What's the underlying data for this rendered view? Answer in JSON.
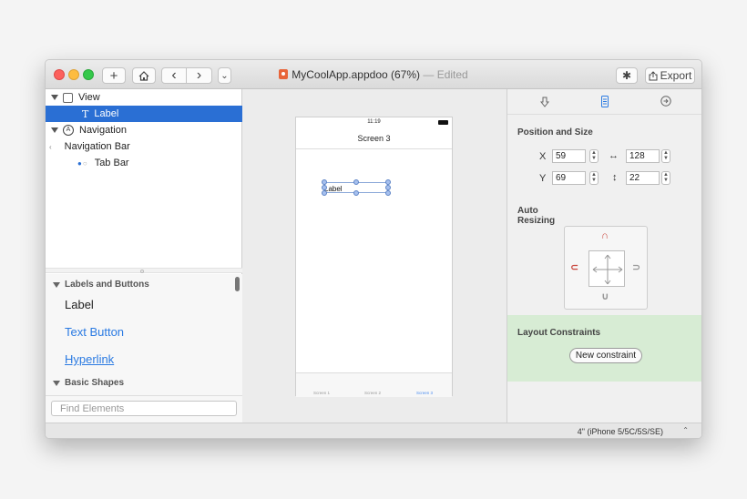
{
  "window": {
    "title_file": "MyCoolApp.appdoo (67%)",
    "title_status": "— Edited",
    "toolbar": {
      "add_icon": "+",
      "home_icon": "house-icon",
      "back_icon": "‹",
      "forward_icon": "›",
      "menu_icon": "⌄",
      "settings_icon": "✱",
      "export_label": "Export"
    }
  },
  "tree": {
    "items": [
      {
        "label": "View",
        "icon": "view-box-icon"
      },
      {
        "label": "Label",
        "icon": "T"
      },
      {
        "label": "Navigation",
        "icon": "navigation-icon"
      },
      {
        "label": "Navigation Bar",
        "icon": "‹"
      },
      {
        "label": "Tab Bar",
        "icon": "tab-dots-icon"
      }
    ]
  },
  "library": {
    "sections": [
      {
        "title": "Labels and Buttons",
        "items": [
          "Label",
          "Text Button",
          "Hyperlink"
        ]
      },
      {
        "title": "Basic Shapes",
        "items": []
      }
    ],
    "search_placeholder": "Find Elements"
  },
  "canvas": {
    "status_time": "11:19",
    "screen_title": "Screen 3",
    "label_text": "Label",
    "tabs": [
      "Screen 1",
      "Screen 2",
      "Screen 3"
    ]
  },
  "inspector": {
    "position_title": "Position and Size",
    "x_label": "X",
    "x_value": "59",
    "y_label": "Y",
    "y_value": "69",
    "width_icon": "↔",
    "width_value": "128",
    "height_icon": "↕",
    "height_value": "22",
    "auto_resizing_line1": "Auto",
    "auto_resizing_line2": "Resizing",
    "layout_title": "Layout Constraints",
    "new_constraint": "New constraint"
  },
  "bottom": {
    "device": "4\" (iPhone 5/5C/5S/SE)",
    "arrows": "⌃⌄"
  },
  "colors": {
    "selection": "#2a6fd4",
    "link": "#2a7ae2",
    "layout_bg": "#d7ecd4"
  }
}
